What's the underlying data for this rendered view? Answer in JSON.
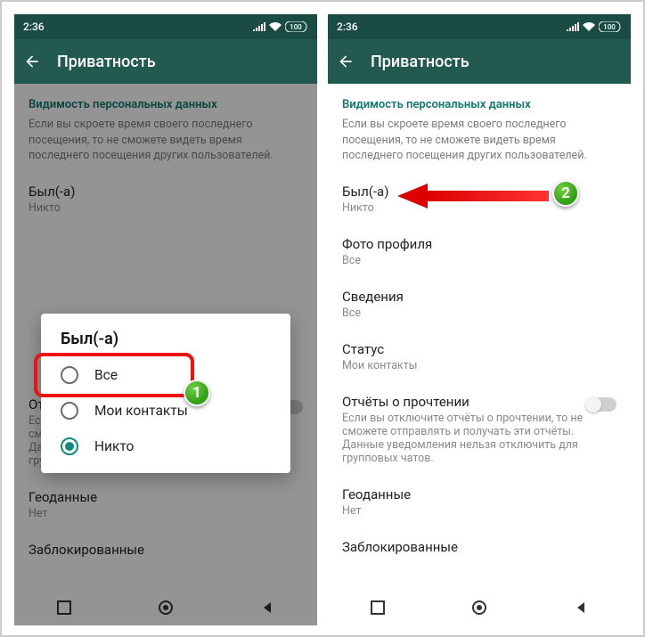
{
  "status": {
    "time": "2:36",
    "battery": "100"
  },
  "header": {
    "title": "Приватность"
  },
  "section": {
    "title": "Видимость персональных данных",
    "desc": "Если вы скроете время своего последнего посещения, то не сможете видеть время последнего посещения других пользователей."
  },
  "items": {
    "lastseen": {
      "title": "Был(-а)",
      "sub": "Никто"
    },
    "photo": {
      "title": "Фото профиля",
      "sub": "Все"
    },
    "about": {
      "title": "Сведения",
      "sub": "Все"
    },
    "status": {
      "title": "Статус",
      "sub": "Мои контакты"
    },
    "read": {
      "title": "Отчёты о прочтении",
      "sub": "Если вы отключите отчёты о прочтении, то не сможете отправлять и получать эти отчёты. Данные уведомления нельзя отключить для групповых чатов."
    },
    "geo": {
      "title": "Геоданные",
      "sub": "Нет"
    },
    "blocked": {
      "title": "Заблокированные"
    }
  },
  "dialog": {
    "title": "Был(-а)",
    "opt_everyone": "Все",
    "opt_contacts": "Мои контакты",
    "opt_nobody": "Никто"
  },
  "callouts": {
    "c1": "1",
    "c2": "2"
  }
}
